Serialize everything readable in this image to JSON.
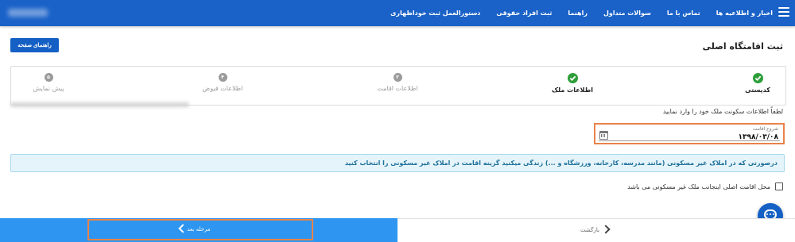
{
  "nav": {
    "items": [
      "اخبار و اطلاعیه ها",
      "تماس با ما",
      "سوالات متداول",
      "راهنما",
      "ثبت افراد حقوقی",
      "دستورالعمل ثبت خوداظهاری"
    ]
  },
  "page": {
    "title": "ثبت اقامتگاه اصلی",
    "guide_button": "راهنمای صفحه"
  },
  "steps": [
    {
      "num": "",
      "label": "کدپستی",
      "status": "done"
    },
    {
      "num": "",
      "label": "اطلاعات ملک",
      "status": "done"
    },
    {
      "num": "۳",
      "label": "اطلاعات اقامت",
      "status": "todo"
    },
    {
      "num": "۴",
      "label": "اطلاعات قبوض",
      "status": "todo"
    },
    {
      "num": "۵",
      "label": "پیش نمایش",
      "status": "todo"
    }
  ],
  "form": {
    "instruction": "لطفاً اطلاعات سکونت ملک خود را وارد نمایید",
    "date_label": "شروع اقامت",
    "date_value": "۱۳۹۸/۰۳/۰۸"
  },
  "info": {
    "text": "درصورتی که در املاک غیر مسکونی (مانند مدرسه، کارخانه، ورزشگاه و ...) زندگی میکنید گزینه اقامت در املاک غیر مسکونی را انتخاب کنید"
  },
  "checkbox": {
    "label": "محل اقامت اصلی اینجانب ملک غیر مسکونی می باشد"
  },
  "footer": {
    "next_label": "مرحله بعد",
    "back_label": "بازگشت"
  },
  "colors": {
    "primary": "#1a62c8",
    "next_button": "#2e96f0",
    "success": "#2e9e3a",
    "highlight": "#e8824a",
    "info_bg": "#e5f4fb"
  }
}
